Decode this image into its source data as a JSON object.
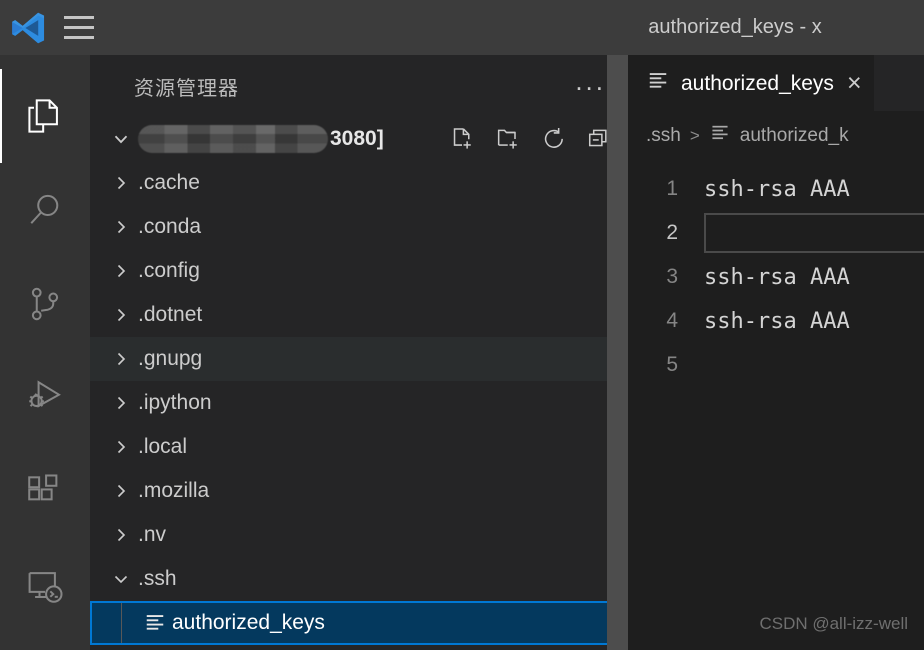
{
  "window": {
    "title": "authorized_keys - x"
  },
  "activity_bar": {
    "items": [
      {
        "name": "explorer",
        "icon": "files-icon",
        "active": true
      },
      {
        "name": "search",
        "icon": "search-icon",
        "active": false
      },
      {
        "name": "source-control",
        "icon": "source-control-icon",
        "active": false
      },
      {
        "name": "run-and-debug",
        "icon": "run-debug-icon",
        "active": false
      },
      {
        "name": "extensions",
        "icon": "extensions-icon",
        "active": false
      },
      {
        "name": "remote-explorer",
        "icon": "remote-explorer-icon",
        "active": false
      }
    ]
  },
  "sidebar": {
    "header_title": "资源管理器",
    "more_actions": "...",
    "root": {
      "name_redacted": true,
      "name_suffix": "3080]",
      "expanded": true,
      "actions": [
        {
          "name": "new-file",
          "label": "新建文件"
        },
        {
          "name": "new-folder",
          "label": "新建文件夹"
        },
        {
          "name": "refresh",
          "label": "刷新资源管理器"
        },
        {
          "name": "collapse-all",
          "label": "在资源管理器中折叠文件夹"
        }
      ]
    },
    "tree": [
      {
        "label": ".cache",
        "type": "folder",
        "expanded": false,
        "depth": 1,
        "state": "normal"
      },
      {
        "label": ".conda",
        "type": "folder",
        "expanded": false,
        "depth": 1,
        "state": "normal"
      },
      {
        "label": ".config",
        "type": "folder",
        "expanded": false,
        "depth": 1,
        "state": "normal"
      },
      {
        "label": ".dotnet",
        "type": "folder",
        "expanded": false,
        "depth": 1,
        "state": "normal"
      },
      {
        "label": ".gnupg",
        "type": "folder",
        "expanded": false,
        "depth": 1,
        "state": "hover"
      },
      {
        "label": ".ipython",
        "type": "folder",
        "expanded": false,
        "depth": 1,
        "state": "normal"
      },
      {
        "label": ".local",
        "type": "folder",
        "expanded": false,
        "depth": 1,
        "state": "normal"
      },
      {
        "label": ".mozilla",
        "type": "folder",
        "expanded": false,
        "depth": 1,
        "state": "normal"
      },
      {
        "label": ".nv",
        "type": "folder",
        "expanded": false,
        "depth": 1,
        "state": "normal"
      },
      {
        "label": ".ssh",
        "type": "folder",
        "expanded": true,
        "depth": 1,
        "state": "normal"
      },
      {
        "label": "authorized_keys",
        "type": "file",
        "expanded": false,
        "depth": 2,
        "state": "selected"
      }
    ]
  },
  "editor": {
    "tab": {
      "label": "authorized_keys",
      "icon": "text-file-icon",
      "close_label": "×",
      "active": true
    },
    "breadcrumbs": [
      {
        "label": ".ssh",
        "icon": null
      },
      {
        "label": "authorized_k",
        "icon": "text-file-icon"
      }
    ],
    "breadcrumb_separator": ">",
    "lines": [
      {
        "number": "1",
        "text": "ssh-rsa AAA",
        "active": false
      },
      {
        "number": "2",
        "text": "",
        "active": true
      },
      {
        "number": "3",
        "text": "ssh-rsa AAA",
        "active": false
      },
      {
        "number": "4",
        "text": "ssh-rsa AAA",
        "active": false
      },
      {
        "number": "5",
        "text": "",
        "active": false
      }
    ]
  },
  "watermark": "CSDN @all-izz-well",
  "colors": {
    "titlebar_bg": "#3c3c3c",
    "activitybar_bg": "#333333",
    "sidebar_bg": "#252526",
    "editor_bg": "#1e1e1e",
    "selection_bg": "#04395e",
    "focus_border": "#0078d4",
    "hover_bg": "#2a2d2e",
    "text": "#cccccc",
    "scrollbar": "#4d4d4d"
  }
}
